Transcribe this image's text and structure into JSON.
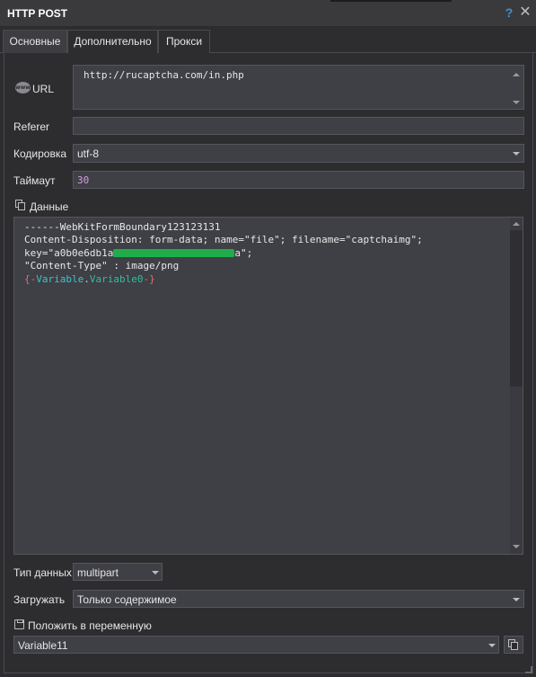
{
  "window": {
    "title": "HTTP POST",
    "help_glyph": "?",
    "close_glyph": "✕"
  },
  "tabs": [
    {
      "label": "Основные",
      "active": true
    },
    {
      "label": "Дополнительно",
      "active": false
    },
    {
      "label": "Прокси",
      "active": false
    }
  ],
  "form": {
    "url": {
      "label": "URL",
      "icon": "www-globe-icon",
      "value": "http://rucaptcha.com/in.php"
    },
    "referer": {
      "label": "Referer",
      "value": ""
    },
    "encoding": {
      "label": "Кодировка",
      "value": "utf-8"
    },
    "timeout": {
      "label": "Таймаут",
      "value": "30"
    },
    "data": {
      "label": "Данные",
      "lines": {
        "l1": "------WebKitFormBoundary123123131",
        "l2": "Content-Disposition: form-data; name=\"file\"; filename=\"captchaimg\";",
        "l3_prefix": "key=\"a0b0e6db1a",
        "l3_suffix": "a\";",
        "l4": "\"Content-Type\" : image/png",
        "l5_open": "{-",
        "l5_name": "Variable",
        "l5_dot": ".",
        "l5_sub": "Variable0",
        "l5_close": "-}"
      }
    },
    "data_type": {
      "label": "Тип данных",
      "value": "multipart"
    },
    "load": {
      "label": "Загружать",
      "value": "Только содержимое"
    },
    "save_to_var": {
      "label": "Положить в переменную",
      "value": "Variable11"
    }
  },
  "colors": {
    "background": "#2d2d30",
    "field": "#3f3f46",
    "help_accent": "#3e8fd6",
    "redaction": "#1fae4a",
    "var_brace": "#e86f5e",
    "var_name": "#3ec3c7",
    "timeout_value": "#d49be0"
  }
}
